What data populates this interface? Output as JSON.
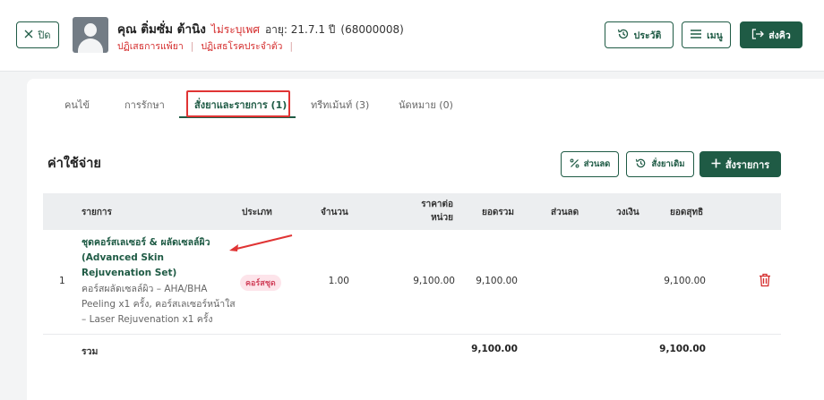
{
  "header": {
    "close_label": "ปิด",
    "patient_name": "คุณ ติ่มซั่ม ต้านิง",
    "gender": "ไม่ระบุเพศ",
    "age_label": "อายุ: 21.7.1 ปี",
    "patient_id": "(68000008)",
    "allergy_drug": "ปฏิเสธการแพ้ยา",
    "allergy_disease": "ปฏิเสธโรคประจำตัว",
    "history_label": "ประวัติ",
    "menu_label": "เมนู",
    "send_label": "ส่งคิว"
  },
  "tabs": [
    {
      "label": "คนไข้"
    },
    {
      "label": "การรักษา"
    },
    {
      "label": "สั่งยาและรายการ (1)"
    },
    {
      "label": "ทรีทเม้นท์ (3)"
    },
    {
      "label": "นัดหมาย (0)"
    }
  ],
  "section": {
    "title": "ค่าใช้จ่าย",
    "discount_label": "ส่วนลด",
    "reorder_label": "สั่งยาเดิม",
    "add_label": "สั่งรายการ"
  },
  "table": {
    "headers": {
      "item": "รายการ",
      "type": "ประเภท",
      "qty": "จำนวน",
      "unit_price": "ราคาต่อ หน่วย",
      "total": "ยอดรวม",
      "discount": "ส่วนลด",
      "limit": "วงเงิน",
      "net": "ยอดสุทธิ"
    },
    "rows": [
      {
        "no": "1",
        "name": "ชุดคอร์สเลเซอร์ & ผลัดเซลล์ผิว (Advanced Skin Rejuvenation Set)",
        "desc": "คอร์สผลัดเซลล์ผิว – AHA/BHA Peeling x1 ครั้ง, คอร์สเลเซอร์หน้าใส – Laser Rejuvenation x1 ครั้ง",
        "type": "คอร์สชุด",
        "qty": "1.00",
        "unit_price": "9,100.00",
        "total": "9,100.00",
        "net": "9,100.00"
      }
    ],
    "summary": {
      "label": "รวม",
      "total": "9,100.00",
      "net": "9,100.00"
    }
  },
  "colors": {
    "brand": "#1f5b45",
    "danger": "#d42b2b",
    "highlight": "#e03434"
  }
}
